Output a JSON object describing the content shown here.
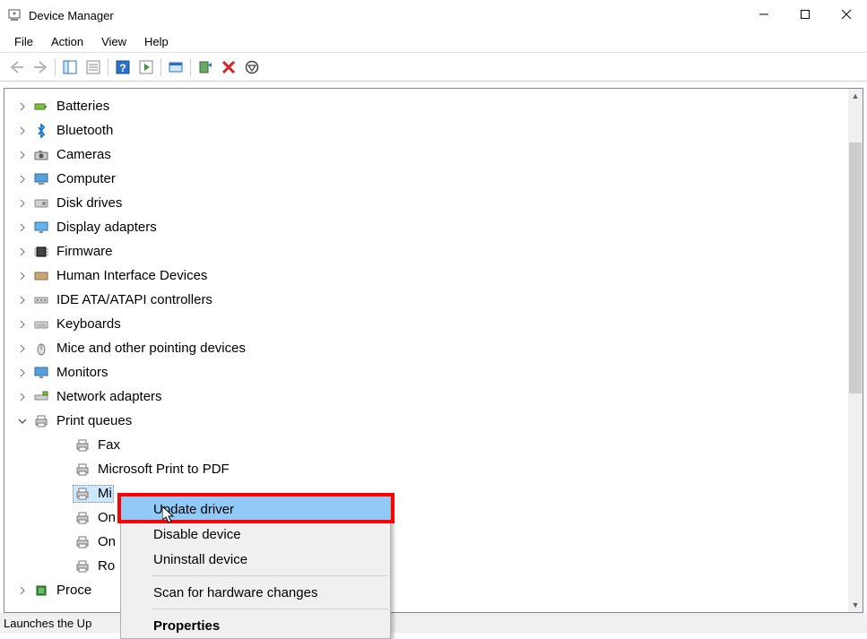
{
  "window": {
    "title": "Device Manager"
  },
  "menu": {
    "items": [
      "File",
      "Action",
      "View",
      "Help"
    ]
  },
  "tree": [
    {
      "label": "Batteries",
      "icon": "battery",
      "expander": "collapsed"
    },
    {
      "label": "Bluetooth",
      "icon": "bluetooth",
      "expander": "collapsed"
    },
    {
      "label": "Cameras",
      "icon": "camera",
      "expander": "collapsed"
    },
    {
      "label": "Computer",
      "icon": "computer",
      "expander": "collapsed"
    },
    {
      "label": "Disk drives",
      "icon": "disk",
      "expander": "collapsed"
    },
    {
      "label": "Display adapters",
      "icon": "display",
      "expander": "collapsed"
    },
    {
      "label": "Firmware",
      "icon": "firmware",
      "expander": "collapsed"
    },
    {
      "label": "Human Interface Devices",
      "icon": "hid",
      "expander": "collapsed"
    },
    {
      "label": "IDE ATA/ATAPI controllers",
      "icon": "ide",
      "expander": "collapsed"
    },
    {
      "label": "Keyboards",
      "icon": "keyboard",
      "expander": "collapsed"
    },
    {
      "label": "Mice and other pointing devices",
      "icon": "mouse",
      "expander": "collapsed"
    },
    {
      "label": "Monitors",
      "icon": "monitor",
      "expander": "collapsed"
    },
    {
      "label": "Network adapters",
      "icon": "network",
      "expander": "collapsed"
    },
    {
      "label": "Print queues",
      "icon": "printer",
      "expander": "expanded",
      "children": [
        {
          "label": "Fax",
          "icon": "printer"
        },
        {
          "label": "Microsoft Print to PDF",
          "icon": "printer"
        },
        {
          "label": "Mi",
          "icon": "printer",
          "selected": true
        },
        {
          "label": "On",
          "icon": "printer"
        },
        {
          "label": "On",
          "icon": "printer"
        },
        {
          "label": "Ro",
          "icon": "printer"
        }
      ]
    },
    {
      "label": "Proce",
      "icon": "processor",
      "expander": "collapsed"
    }
  ],
  "context_menu": {
    "items": [
      {
        "label": "Update driver",
        "highlighted": true
      },
      {
        "label": "Disable device"
      },
      {
        "label": "Uninstall device"
      },
      {
        "sep": true
      },
      {
        "label": "Scan for hardware changes"
      },
      {
        "sep": true
      },
      {
        "label": "Properties",
        "strong": true
      }
    ]
  },
  "statusbar": {
    "text": "Launches the Up"
  }
}
